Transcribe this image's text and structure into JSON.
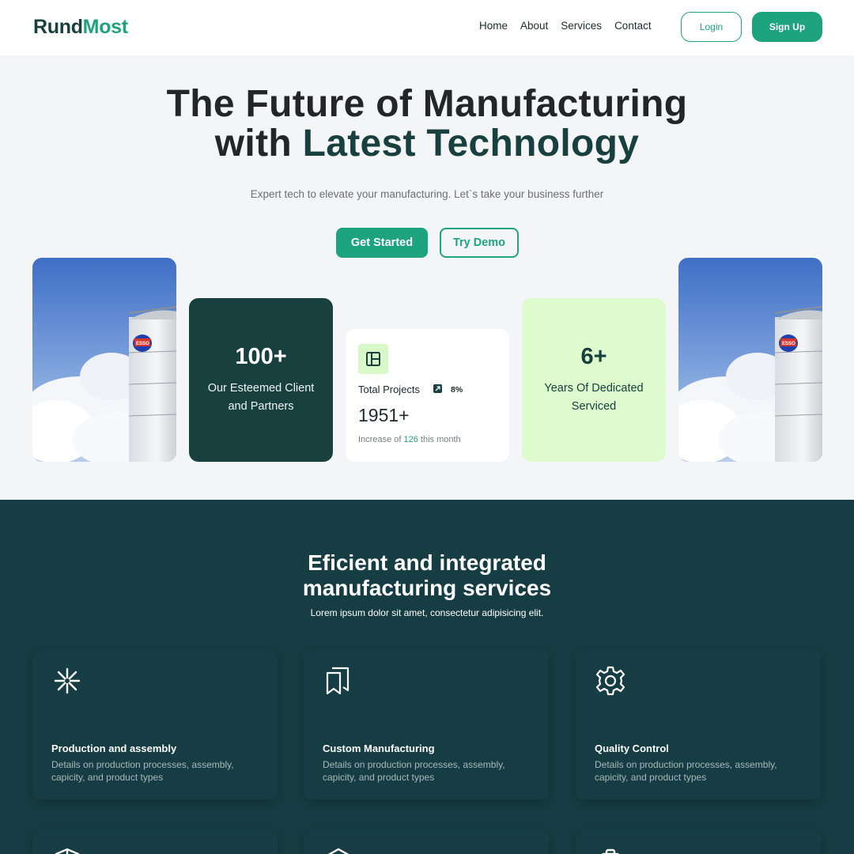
{
  "nav": {
    "logo_part1": "Rund",
    "logo_part2": "Most",
    "links": [
      "Home",
      "About",
      "Services",
      "Contact"
    ],
    "login_label": "Login",
    "signup_label": "Sign Up"
  },
  "hero": {
    "title_line1": "The Future of Manufacturing",
    "title_line2_prefix": "with ",
    "title_line2_highlight": "Latest Technology",
    "subtitle": "Expert tech to elevate your manufacturing. Let`s take your business further",
    "get_started_label": "Get Started",
    "try_demo_label": "Try Demo"
  },
  "stats": {
    "clients_number": "100+",
    "clients_label": "Our Esteemed Client and Partners",
    "projects_label": "Total Projects",
    "projects_percent": "8%",
    "projects_number": "1951+",
    "projects_increase_prefix": "Increase of ",
    "projects_increase_value": "126",
    "projects_increase_suffix": " this month",
    "years_number": "6+",
    "years_label": "Years Of Dedicated Serviced"
  },
  "services": {
    "title_line1": "Eficient and integrated",
    "title_line2": "manufacturing services",
    "subtitle": "Lorem ipsum dolor sit amet, consectetur adipisicing elit.",
    "cards": [
      {
        "icon": "sparkle-icon",
        "title": "Production and assembly",
        "desc": "Details on production processes, assembly, capicity, and product types"
      },
      {
        "icon": "bookmarks-icon",
        "title": "Custom Manufacturing",
        "desc": "Details on production processes, assembly, capicity, and product types"
      },
      {
        "icon": "gear-icon",
        "title": "Quality Control",
        "desc": "Details on production processes, assembly, capicity, and product types"
      }
    ],
    "more_icons": [
      "shield-icon",
      "box-icon",
      "clipboard-icon"
    ]
  },
  "colors": {
    "brand_dark": "#17403f",
    "brand_green": "#1ea37f",
    "mint": "#ddfbcc",
    "services_bg": "#163d43"
  }
}
